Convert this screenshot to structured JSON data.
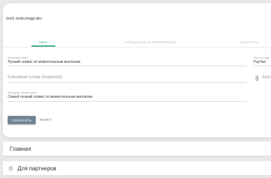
{
  "site": {
    "url": "test1-mobi.heggi.dev"
  },
  "tabs": [
    {
      "label": "MEM",
      "active": true
    },
    {
      "label": "ЮРИДИЧЕСКАЯ ИНФОРМАЦИЯ",
      "active": false
    },
    {
      "label": "КОНТАКТЫ",
      "active": false
    }
  ],
  "form": {
    "title": {
      "label": "Заголовок (title)",
      "value": "Лучший сервис по моментальным выплатам"
    },
    "keywords": {
      "placeholder": "Ключевые слова (keywords)"
    },
    "description": {
      "label": "Описание (description)",
      "value": "Самый лучший сервис по моментальным выплатам"
    },
    "right_text": {
      "label": "Текст в подв",
      "value": "PayTaxi"
    },
    "upload": {
      "label": "Загр"
    }
  },
  "actions": {
    "save_label": "СОХРАНИТЬ",
    "reset_label": "RESET"
  },
  "sections": [
    {
      "label": "Главная"
    },
    {
      "label": "Для партнеров"
    }
  ],
  "colors": {
    "accent": "#3fae8f",
    "button": "#6f8594",
    "background": "#e9e9e9"
  },
  "icons": {
    "attachment": "paperclip-icon",
    "drag": "drag-handle-icon"
  }
}
